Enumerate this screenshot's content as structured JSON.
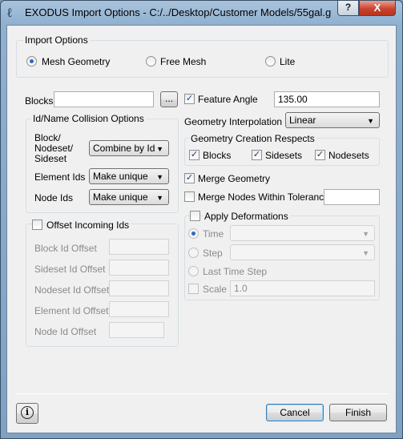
{
  "window": {
    "title": "EXODUS Import Options - C:/../Desktop/Customer Models/55gal.g",
    "help_button": "?",
    "close_button": "X"
  },
  "import_options": {
    "title": "Import Options",
    "mesh_geometry": "Mesh Geometry",
    "free_mesh": "Free Mesh",
    "lite": "Lite",
    "selected": "Mesh Geometry"
  },
  "blocks": {
    "label": "Blocks",
    "value": "",
    "browse_label": "..."
  },
  "feature_angle": {
    "label": "Feature Angle",
    "checked": true,
    "value": "135.00"
  },
  "collision": {
    "title": "Id/Name Collision Options",
    "block_label_1": "Block/",
    "block_label_2": "Nodeset/",
    "block_label_3": "Sideset",
    "block_value": "Combine by Id",
    "element_ids_label": "Element Ids",
    "element_ids_value": "Make unique",
    "node_ids_label": "Node Ids",
    "node_ids_value": "Make unique"
  },
  "geometry_interpolation": {
    "label": "Geometry Interpolation",
    "value": "Linear"
  },
  "creation_respects": {
    "title": "Geometry Creation Respects",
    "blocks": "Blocks",
    "sidesets": "Sidesets",
    "nodesets": "Nodesets"
  },
  "merge_geometry": {
    "label": "Merge Geometry",
    "checked": true
  },
  "merge_nodes": {
    "label": "Merge Nodes Within Tolerance",
    "checked": false,
    "value": ""
  },
  "offset": {
    "label": "Offset Incoming Ids",
    "checked": false,
    "block": "Block Id Offset",
    "sideset": "Sideset Id Offset",
    "nodeset": "Nodeset Id Offset",
    "element": "Element Id Offset",
    "node": "Node Id Offset"
  },
  "deformations": {
    "label": "Apply Deformations",
    "checked": false,
    "time": "Time",
    "step": "Step",
    "last_time_step": "Last Time Step",
    "scale": "Scale",
    "scale_value": "1.0"
  },
  "footer": {
    "info_icon": "i",
    "cancel": "Cancel",
    "finish": "Finish"
  }
}
